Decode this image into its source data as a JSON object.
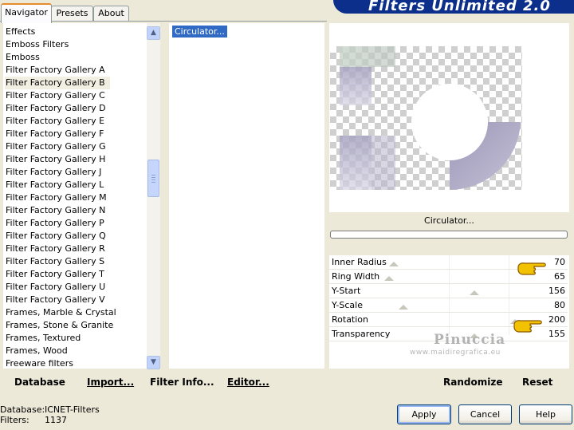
{
  "tabs": [
    {
      "label": "Navigator",
      "active": true
    },
    {
      "label": "Presets",
      "active": false
    },
    {
      "label": "About",
      "active": false
    }
  ],
  "banner_title": "Filters Unlimited 2.0",
  "categories": [
    "Effects",
    "Emboss Filters",
    "Emboss",
    "Filter Factory Gallery A",
    "Filter Factory Gallery B",
    "Filter Factory Gallery C",
    "Filter Factory Gallery D",
    "Filter Factory Gallery E",
    "Filter Factory Gallery F",
    "Filter Factory Gallery G",
    "Filter Factory Gallery H",
    "Filter Factory Gallery J",
    "Filter Factory Gallery L",
    "Filter Factory Gallery M",
    "Filter Factory Gallery N",
    "Filter Factory Gallery P",
    "Filter Factory Gallery Q",
    "Filter Factory Gallery R",
    "Filter Factory Gallery S",
    "Filter Factory Gallery T",
    "Filter Factory Gallery U",
    "Filter Factory Gallery V",
    "Frames, Marble & Crystal",
    "Frames, Stone & Granite",
    "Frames, Textured",
    "Frames, Wood",
    "Freeware filters"
  ],
  "selected_category_index": 4,
  "filters": [
    "Circulator..."
  ],
  "preview_filter_name": "Circulator...",
  "parameters": [
    {
      "name": "Inner Radius",
      "value": "70",
      "fraction": 0.27
    },
    {
      "name": "Ring Width",
      "value": "65",
      "fraction": 0.25
    },
    {
      "name": "Y-Start",
      "value": "156",
      "fraction": 0.61
    },
    {
      "name": "Y-Scale",
      "value": "80",
      "fraction": 0.31
    },
    {
      "name": "Rotation",
      "value": "200",
      "fraction": 0.78
    },
    {
      "name": "Transparency",
      "value": "155",
      "fraction": 0.61
    }
  ],
  "watermark": "Pinuccia",
  "watermark_url": "www.maidiregrafica.eu",
  "toolbar": {
    "database": "Database",
    "import": "Import...",
    "filter_info": "Filter Info...",
    "editor": "Editor...",
    "randomize": "Randomize",
    "reset": "Reset"
  },
  "status": {
    "database_label": "Database:",
    "database_value": "ICNET-Filters",
    "filters_label": "Filters:",
    "filters_value": "1137"
  },
  "buttons": {
    "apply": "Apply",
    "cancel": "Cancel",
    "help": "Help"
  },
  "colors": {
    "banner": "#0b2f8a",
    "selection": "#316ac5",
    "ring": "#a9a6c2"
  }
}
